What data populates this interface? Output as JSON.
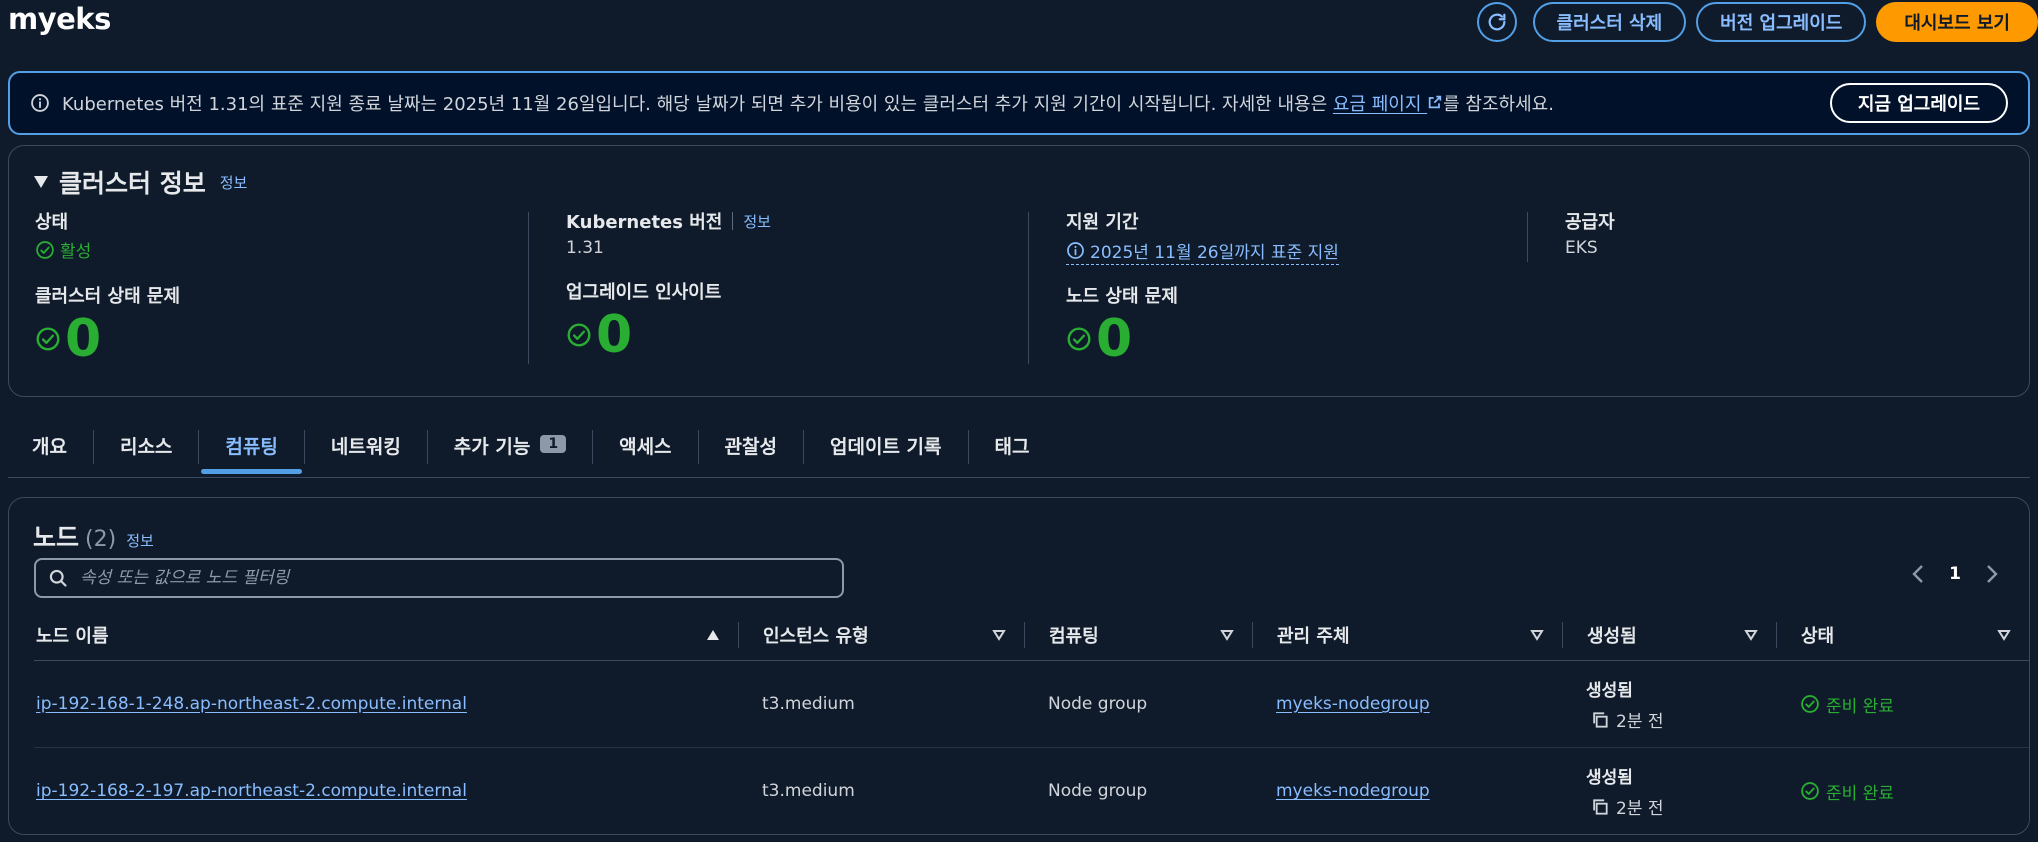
{
  "header": {
    "cluster_name": "myeks",
    "delete_label": "클러스터 삭제",
    "upgrade_label": "버전 업그레이드",
    "dashboard_label": "대시보드 보기"
  },
  "alert": {
    "text_before": "Kubernetes 버전 1.31의 표준 지원 종료 날짜는 2025년 11월 26일입니다. 해당 날짜가 되면 추가 비용이 있는 클러스터 추가 지원 기간이 시작됩니다. 자세한 내용은 ",
    "link_text": "요금 페이지",
    "text_after": "를 참조하세요.",
    "button_label": "지금 업그레이드"
  },
  "cluster_info": {
    "title": "클러스터 정보",
    "info_link": "정보",
    "status_label": "상태",
    "status_value": "활성",
    "k8s_label": "Kubernetes 버전",
    "k8s_info_link": "정보",
    "k8s_value": "1.31",
    "support_label": "지원 기간",
    "support_value": "2025년 11월 26일까지 표준 지원",
    "provider_label": "공급자",
    "provider_value": "EKS",
    "health_label": "클러스터 상태 문제",
    "health_value": "0",
    "insights_label": "업그레이드 인사이트",
    "insights_value": "0",
    "node_health_label": "노드 상태 문제",
    "node_health_value": "0"
  },
  "tabs": [
    {
      "label": "개요"
    },
    {
      "label": "리소스"
    },
    {
      "label": "컴퓨팅",
      "active": true
    },
    {
      "label": "네트워킹"
    },
    {
      "label": "추가 기능",
      "badge": "1"
    },
    {
      "label": "액세스"
    },
    {
      "label": "관찰성"
    },
    {
      "label": "업데이트 기록"
    },
    {
      "label": "태그"
    }
  ],
  "nodes": {
    "title": "노드",
    "count": "(2)",
    "info_link": "정보",
    "search_placeholder": "속성 또는 값으로 노드 필터링",
    "page": "1",
    "columns": [
      "노드 이름",
      "인스턴스 유형",
      "컴퓨팅",
      "관리 주체",
      "생성됨",
      "상태"
    ],
    "rows": [
      {
        "name": "ip-192-168-1-248.ap-northeast-2.compute.internal",
        "instance_type": "t3.medium",
        "compute": "Node group",
        "managed_by": "myeks-nodegroup",
        "created_label": "생성됨",
        "created_ago": "2분 전",
        "status": "준비 완료"
      },
      {
        "name": "ip-192-168-2-197.ap-northeast-2.compute.internal",
        "instance_type": "t3.medium",
        "compute": "Node group",
        "managed_by": "myeks-nodegroup",
        "created_label": "생성됨",
        "created_ago": "2분 전",
        "status": "준비 완료"
      }
    ]
  }
}
